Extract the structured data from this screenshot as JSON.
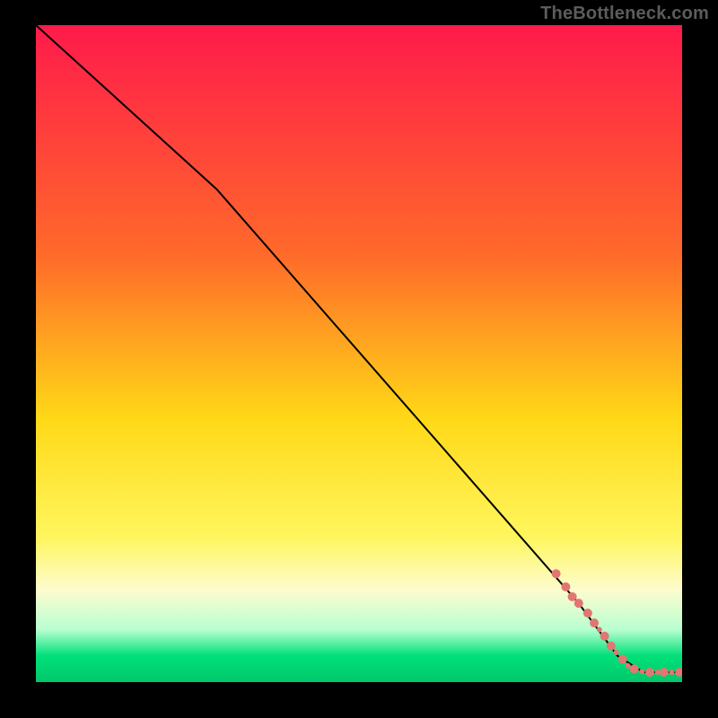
{
  "attribution": "TheBottleneck.com",
  "chart_data": {
    "type": "line",
    "title": "",
    "xlabel": "",
    "ylabel": "",
    "xlim": [
      0,
      100
    ],
    "ylim": [
      0,
      100
    ],
    "grid": false,
    "background_gradient": {
      "stops": [
        {
          "offset": 0,
          "color": "#ff1a4b"
        },
        {
          "offset": 35,
          "color": "#ff6a2a"
        },
        {
          "offset": 60,
          "color": "#ffd917"
        },
        {
          "offset": 78,
          "color": "#fff65e"
        },
        {
          "offset": 86,
          "color": "#fdfccf"
        },
        {
          "offset": 92,
          "color": "#b8ffd0"
        },
        {
          "offset": 96,
          "color": "#00e07a"
        },
        {
          "offset": 100,
          "color": "#00c86a"
        }
      ]
    },
    "series": [
      {
        "name": "curve",
        "color": "#000000",
        "stroke_width": 2,
        "points": [
          {
            "x": 0,
            "y": 100
          },
          {
            "x": 28,
            "y": 75
          },
          {
            "x": 84,
            "y": 12
          },
          {
            "x": 90,
            "y": 4
          },
          {
            "x": 94,
            "y": 1.5
          },
          {
            "x": 100,
            "y": 1.5
          }
        ]
      },
      {
        "name": "tail-markers",
        "color": "#e17770",
        "marker_radius_large": 5,
        "marker_radius_small": 3,
        "points": [
          {
            "x": 80.5,
            "y": 16.5,
            "r": "large"
          },
          {
            "x": 82.0,
            "y": 14.5,
            "r": "large"
          },
          {
            "x": 83.0,
            "y": 13.0,
            "r": "large"
          },
          {
            "x": 84.0,
            "y": 12.0,
            "r": "large"
          },
          {
            "x": 85.4,
            "y": 10.5,
            "r": "large"
          },
          {
            "x": 86.4,
            "y": 9.0,
            "r": "large"
          },
          {
            "x": 87.2,
            "y": 8.0,
            "r": "small"
          },
          {
            "x": 88.0,
            "y": 7.0,
            "r": "large"
          },
          {
            "x": 89.0,
            "y": 5.5,
            "r": "large"
          },
          {
            "x": 89.8,
            "y": 4.5,
            "r": "small"
          },
          {
            "x": 90.8,
            "y": 3.5,
            "r": "large"
          },
          {
            "x": 91.6,
            "y": 2.5,
            "r": "small"
          },
          {
            "x": 92.6,
            "y": 2.0,
            "r": "large"
          },
          {
            "x": 93.8,
            "y": 1.6,
            "r": "small"
          },
          {
            "x": 95.0,
            "y": 1.5,
            "r": "large"
          },
          {
            "x": 96.2,
            "y": 1.5,
            "r": "small"
          },
          {
            "x": 97.2,
            "y": 1.5,
            "r": "large"
          },
          {
            "x": 98.4,
            "y": 1.5,
            "r": "small"
          },
          {
            "x": 99.6,
            "y": 1.5,
            "r": "large"
          }
        ]
      }
    ]
  }
}
